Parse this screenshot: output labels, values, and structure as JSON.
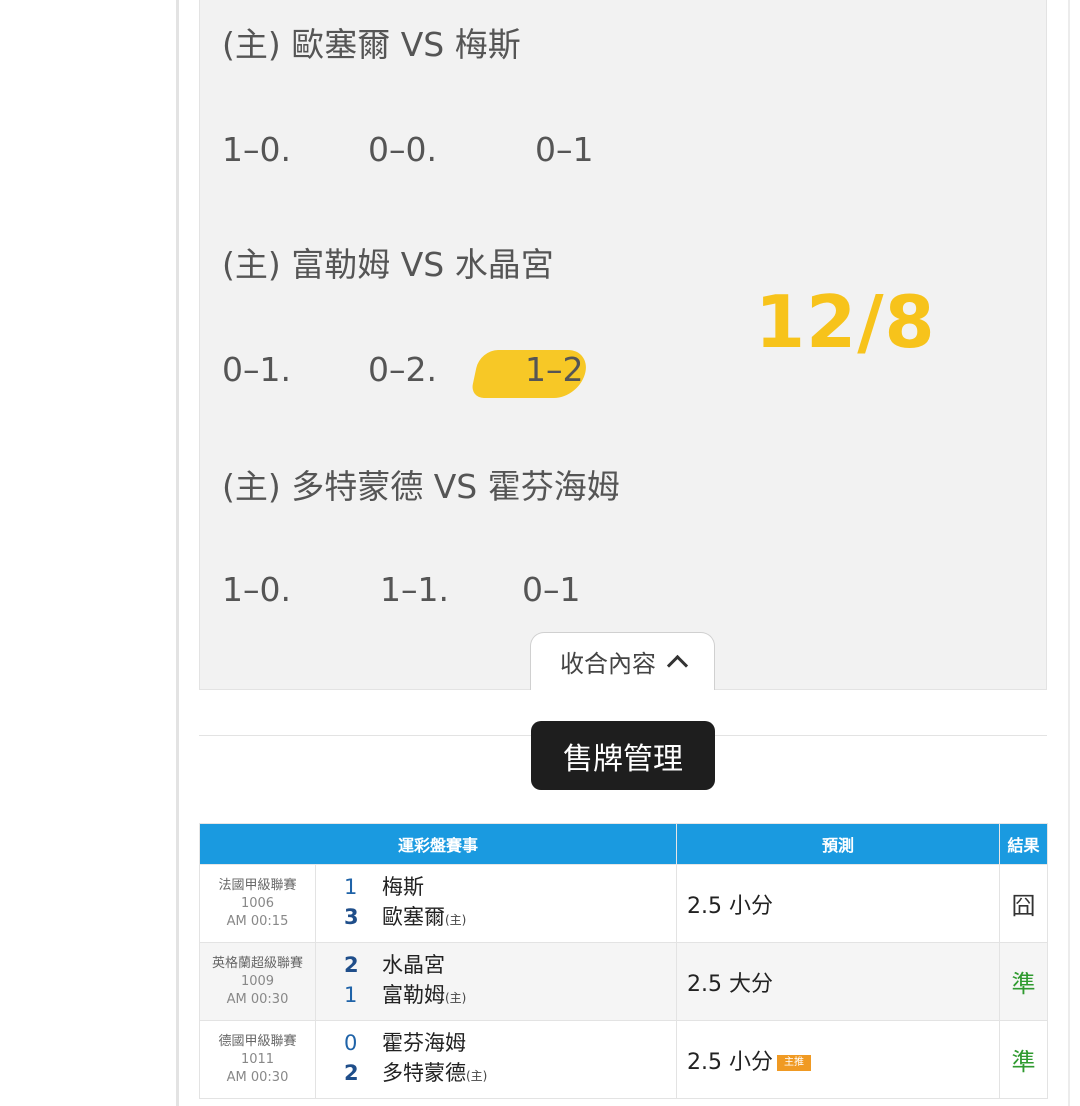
{
  "notes": {
    "date_stamp": "12/8",
    "matches": [
      {
        "title": "(主) 歐塞爾 VS 梅斯",
        "scores": [
          "1–0.",
          "0–0.",
          "0–1"
        ]
      },
      {
        "title": "(主) 富勒姆 VS 水晶宮",
        "scores": [
          "0–1.",
          "0–2.",
          "1–2"
        ],
        "highlighted_score_index": 2
      },
      {
        "title": "(主) 多特蒙德 VS 霍芬海姆",
        "scores": [
          "1–0.",
          "1–1.",
          "0–1"
        ]
      }
    ],
    "collapse_label": "收合內容",
    "highlight_color": "#f7c51a",
    "date_stamp_color": "#f7c31b"
  },
  "section_button": "售牌管理",
  "table": {
    "headers": [
      "運彩盤賽事",
      "預測",
      "結果"
    ],
    "header_color": "#1a9ae0",
    "rows": [
      {
        "league": "法國甲級聯賽",
        "code": "1006",
        "time": "AM 00:15",
        "teams": [
          {
            "score": "1",
            "name": "梅斯",
            "host": ""
          },
          {
            "score": "3",
            "name": "歐塞爾",
            "host": "(主)"
          }
        ],
        "prediction": "2.5 小分",
        "badge": "",
        "result": "囧"
      },
      {
        "league": "英格蘭超級聯賽",
        "code": "1009",
        "time": "AM 00:30",
        "teams": [
          {
            "score": "2",
            "name": "水晶宮",
            "host": ""
          },
          {
            "score": "1",
            "name": "富勒姆",
            "host": "(主)"
          }
        ],
        "prediction": "2.5 大分",
        "badge": "",
        "result": "準"
      },
      {
        "league": "德國甲級聯賽",
        "code": "1011",
        "time": "AM 00:30",
        "teams": [
          {
            "score": "0",
            "name": "霍芬海姆",
            "host": ""
          },
          {
            "score": "2",
            "name": "多特蒙德",
            "host": "(主)"
          }
        ],
        "prediction": "2.5 小分",
        "badge": "主推",
        "result": "準"
      }
    ]
  }
}
